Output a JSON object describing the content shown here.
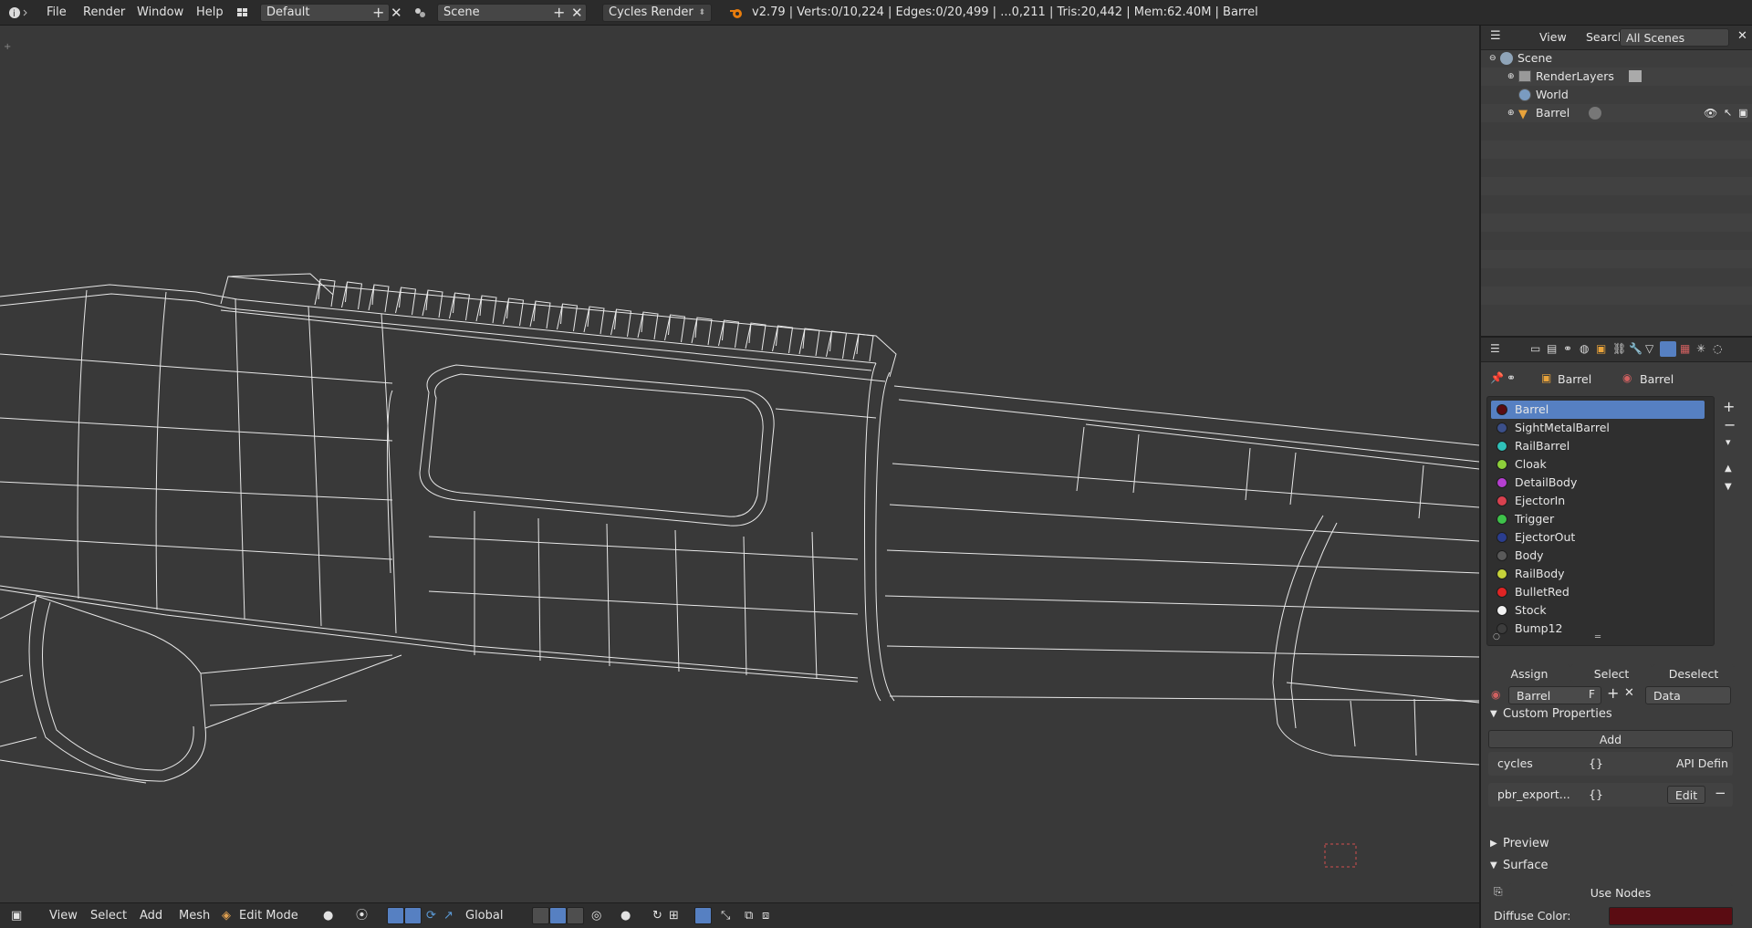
{
  "topbar": {
    "menus": [
      "File",
      "Render",
      "Window",
      "Help"
    ],
    "screen_layout": "Default",
    "scene": "Scene",
    "render_engine": "Cycles Render",
    "stats": "v2.79 | Verts:0/10,224 | Edges:0/20,499 | ...0,211 | Tris:20,442 | Mem:62.40M | Barrel"
  },
  "bottombar": {
    "menus": [
      "View",
      "Select",
      "Add",
      "Mesh"
    ],
    "mode": "Edit Mode",
    "orientation": "Global"
  },
  "outliner": {
    "menus": [
      "View",
      "Search"
    ],
    "filter": "All Scenes",
    "tree": [
      {
        "label": "Scene",
        "icon": "scene-icon"
      },
      {
        "label": "RenderLayers",
        "icon": "render-layers-icon"
      },
      {
        "label": "World",
        "icon": "world-icon"
      },
      {
        "label": "Barrel",
        "icon": "mesh-object-icon"
      }
    ]
  },
  "properties": {
    "breadcrumb": [
      "Barrel",
      "Barrel"
    ],
    "materials": [
      {
        "name": "Barrel",
        "color": "#5a0c12",
        "selected": true
      },
      {
        "name": "SightMetalBarrel",
        "color": "#3b4f8a"
      },
      {
        "name": "RailBarrel",
        "color": "#2fc0b8"
      },
      {
        "name": "Cloak",
        "color": "#8dcf3a"
      },
      {
        "name": "DetailBody",
        "color": "#b63fd1"
      },
      {
        "name": "EjectorIn",
        "color": "#d9414f"
      },
      {
        "name": "Trigger",
        "color": "#3ec24a"
      },
      {
        "name": "EjectorOut",
        "color": "#2a3d8f"
      },
      {
        "name": "Body",
        "color": "#5a5a5a"
      },
      {
        "name": "RailBody",
        "color": "#c6d23a"
      },
      {
        "name": "BulletRed",
        "color": "#e02424"
      },
      {
        "name": "Stock",
        "color": "#f2f2f2"
      },
      {
        "name": "Bump12",
        "color": "#3d3d3d"
      }
    ],
    "buttons": {
      "assign": "Assign",
      "select": "Select",
      "deselect": "Deselect"
    },
    "material_field": {
      "name": "Barrel",
      "fake_user": "F",
      "link": "Data"
    },
    "custom_properties": {
      "title": "Custom Properties",
      "add": "Add",
      "rows": [
        {
          "key": "cycles",
          "value": "{}",
          "action": "API Defin"
        },
        {
          "key": "pbr_export...",
          "value": "{}",
          "action": "Edit"
        }
      ]
    },
    "preview": "Preview",
    "surface": "Surface",
    "use_nodes": "Use Nodes",
    "diffuse_label": "Diffuse Color:",
    "diffuse_color": "#5a0c12"
  }
}
